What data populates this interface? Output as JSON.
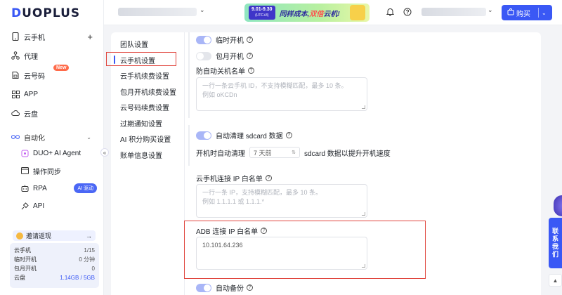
{
  "brand": {
    "logo": "DUOPLUS"
  },
  "sidebar": {
    "items": [
      {
        "label": "云手机",
        "icon": "phone-icon"
      },
      {
        "label": "代理",
        "icon": "network-icon"
      },
      {
        "label": "云号码",
        "icon": "sim-icon",
        "badge": "New"
      },
      {
        "label": "APP",
        "icon": "apps-grid-icon"
      },
      {
        "label": "云盘",
        "icon": "cloud-icon"
      }
    ],
    "group": {
      "label": "自动化",
      "items": [
        {
          "label": "DUO+ AI Agent"
        },
        {
          "label": "操作同步"
        },
        {
          "label": "RPA",
          "badge": "AI 驱动"
        },
        {
          "label": "API"
        }
      ]
    },
    "invite_label": "邀请返现",
    "usage": [
      {
        "label": "云手机",
        "value": "1/15"
      },
      {
        "label": "临时开机",
        "value": "0 分钟"
      },
      {
        "label": "包月开机",
        "value": "0"
      },
      {
        "label": "云盘",
        "value": "1.14GB / 5GB"
      }
    ]
  },
  "header": {
    "promo": {
      "date": "9.01-9.30",
      "date_tz": "(UTC+8)",
      "slogan_a": "同样成本,",
      "slogan_b": "双倍",
      "slogan_c": "云机!"
    },
    "buy_label": "购买"
  },
  "subnav": [
    "团队设置",
    "云手机设置",
    "云手机续费设置",
    "包月开机续费设置",
    "云号码续费设置",
    "过期通知设置",
    "AI 积分购买设置",
    "账单信息设置"
  ],
  "form": {
    "temp_boot_label": "临时开机",
    "temp_boot_on": true,
    "monthly_boot_label": "包月开机",
    "monthly_boot_on": false,
    "no_shutdown_label": "防自动关机名单",
    "no_shutdown_placeholder_1": "一行一条云手机 ID，不支持模糊匹配，最多 10 条。",
    "no_shutdown_placeholder_2": "例如 oKCDn",
    "sdcard_label": "自动清理 sdcard 数据",
    "sdcard_on": true,
    "clean_prefix": "开机时自动清理",
    "clean_value": "7 天前",
    "clean_suffix": "sdcard 数据以提升开机速度",
    "ip_whitelist_label": "云手机连接 IP 白名单",
    "ip_placeholder_1": "一行一条 IP，支持模糊匹配，最多 10 条。",
    "ip_placeholder_2": "例如 1.1.1.1 或 1.1.1.*",
    "adb_label": "ADB 连接 IP 白名单",
    "adb_value": "10.101.64.236",
    "auto_backup_label": "自动备份"
  },
  "float": {
    "contact": [
      "联",
      "系",
      "我",
      "们"
    ]
  }
}
